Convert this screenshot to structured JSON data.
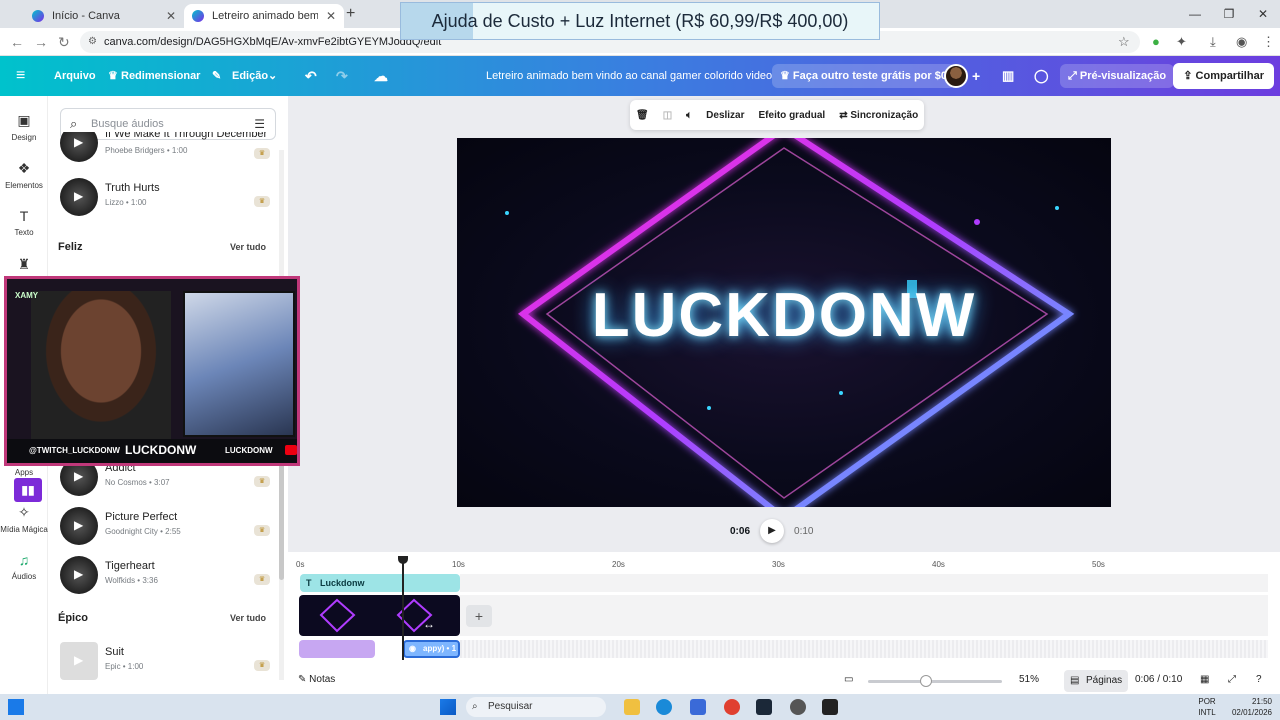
{
  "browser": {
    "tabs": [
      {
        "title": "Início - Canva"
      },
      {
        "title": "Letreiro animado bem vindo ao canal"
      }
    ],
    "url": "canva.com/design/DAG5HGXbMqE/Av-xmvFe2ibtGYEYMJoddQ/edit",
    "overlay_banner": "Ajuda de Custo + Luz Internet (R$ 60,99/R$ 400,00)"
  },
  "toolbar": {
    "arquivo": "Arquivo",
    "redimensionar": "Redimensionar",
    "edicao": "Edição",
    "doc_title": "Letreiro animado bem vindo ao canal gamer colorido video",
    "trial": "Faça outro teste grátis por $0",
    "preview": "Pré-visualização",
    "share": "Compartilhar"
  },
  "rail": [
    {
      "label": "Design",
      "icon": "design-icon"
    },
    {
      "label": "Elementos",
      "icon": "elements-icon"
    },
    {
      "label": "Texto",
      "icon": "text-icon"
    },
    {
      "label": "Apps",
      "icon": "apps-icon"
    },
    {
      "label": "Mídia Mágica",
      "icon": "magic-media-icon"
    },
    {
      "label": "Áudios",
      "icon": "audio-icon"
    }
  ],
  "panel": {
    "search_placeholder": "Busque áudios",
    "tracks_top": [
      {
        "name": "If We Make It Through December",
        "meta": "Phoebe Bridgers • 1:00"
      },
      {
        "name": "Truth Hurts",
        "meta": "Lizzo • 1:00"
      }
    ],
    "section_feliz": "Feliz",
    "see_all": "Ver tudo",
    "tracks_mid": [
      {
        "name": "Addict",
        "meta": "No Cosmos • 3:07"
      },
      {
        "name": "Picture Perfect",
        "meta": "Goodnight City • 2:55"
      },
      {
        "name": "Tigerheart",
        "meta": "Wolfkids • 3:36"
      }
    ],
    "section_epico": "Épico",
    "tracks_bottom": [
      {
        "name": "Suit",
        "meta": "Epic • 1:00"
      }
    ]
  },
  "webcam": {
    "handle": "@TWITCH_LUCKDONW",
    "brand": "LUCKDONW",
    "brand2": "LUCKDONW"
  },
  "context_toolbar": {
    "deslizar": "Deslizar",
    "efeito": "Efeito gradual",
    "sync": "Sincronização"
  },
  "canvas": {
    "title_text": "LUCKDONW"
  },
  "player": {
    "current": "0:06",
    "total": "0:10"
  },
  "timeline": {
    "ticks": [
      "0s",
      "10s",
      "20s",
      "30s",
      "40s",
      "50s"
    ],
    "text_clip": "Luckdonw",
    "audio_clip": "appy) • 1"
  },
  "bottom": {
    "notas": "Notas",
    "zoom": "51%",
    "paginas": "Páginas",
    "time": "0:06 / 0:10"
  },
  "taskbar": {
    "search": "Pesquisar",
    "lang1": "POR",
    "lang2": "INTL",
    "time": "21:50",
    "date": "02/01/2026"
  },
  "colors": {
    "accent_start": "#00c2cc",
    "accent_end": "#6c3ddf",
    "neon_pink": "#ff2bd6",
    "neon_cyan": "#3ad6ff"
  }
}
